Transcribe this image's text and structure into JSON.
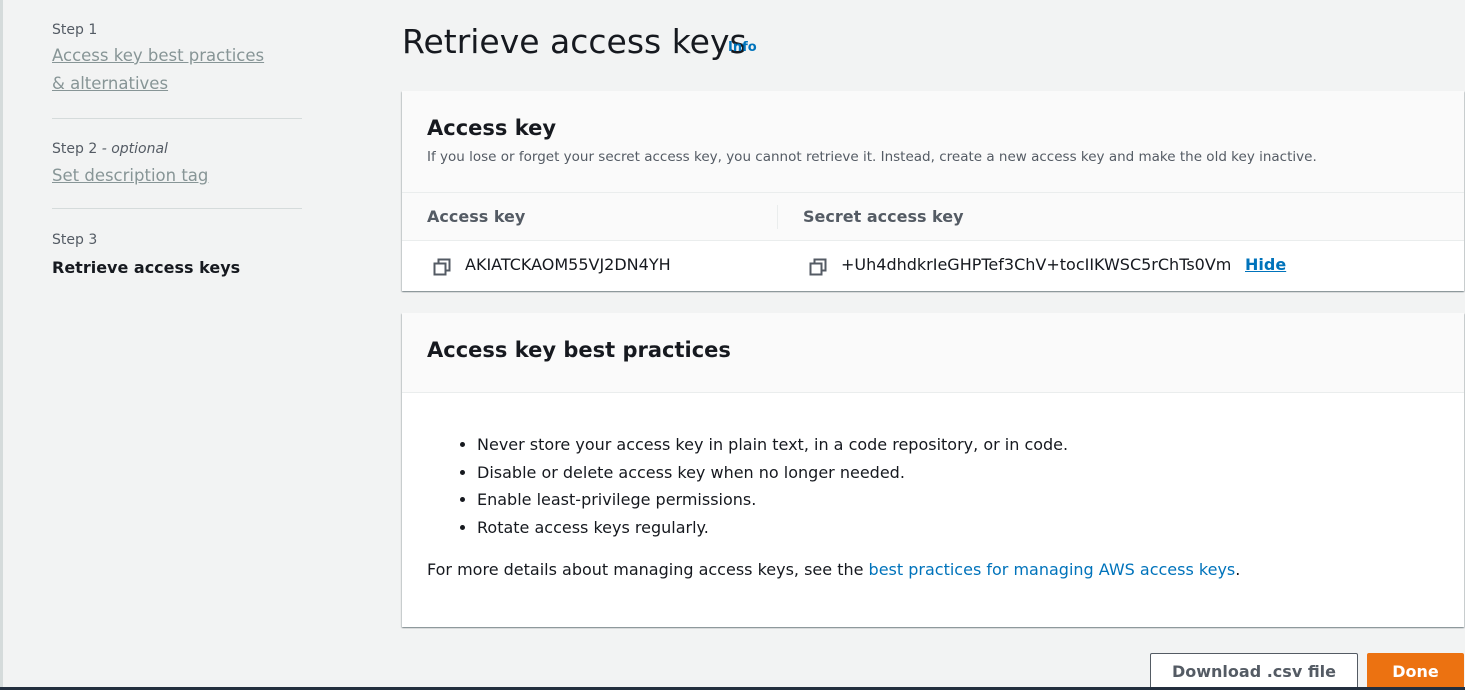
{
  "stepper": {
    "steps": [
      {
        "label": "Step 1",
        "title": "Access key best practices & alternatives"
      },
      {
        "label": "Step 2",
        "optional": "- optional",
        "title": "Set description tag"
      },
      {
        "label": "Step 3",
        "title": "Retrieve access keys"
      }
    ]
  },
  "header": {
    "title": "Retrieve access keys",
    "info_link": "Info"
  },
  "access_key_panel": {
    "title": "Access key",
    "description": "If you lose or forget your secret access key, you cannot retrieve it. Instead, create a new access key and make the old key inactive.",
    "columns": [
      "Access key",
      "Secret access key"
    ],
    "access_key": "AKIATCKAOM55VJ2DN4YH",
    "secret_access_key": "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",
    "hide_label": "Hide",
    "copy_icon": "copy-icon"
  },
  "best_practices": {
    "title": "Access key best practices",
    "items": [
      "Never store your access key in plain text, in a code repository, or in code.",
      "Disable or delete access key when no longer needed.",
      "Enable least-privilege permissions.",
      "Rotate access keys regularly."
    ],
    "more_prefix": "For more details about managing access keys, see the ",
    "more_link": "best practices for managing AWS access keys",
    "more_suffix": "."
  },
  "footer": {
    "download_label": "Download .csv file",
    "done_label": "Done"
  },
  "colors": {
    "link": "#0073bb",
    "primary_button": "#ec7211",
    "background": "#f2f3f3"
  }
}
